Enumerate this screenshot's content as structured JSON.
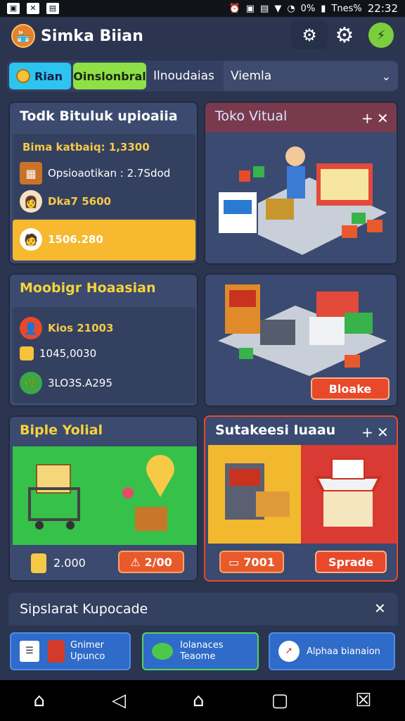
{
  "status_bar": {
    "left_icons": [
      "notification-icon",
      "close-icon",
      "gallery-icon"
    ],
    "battery": "0%",
    "network": "Tnes%",
    "time": "22:32"
  },
  "header": {
    "title": "Simka Biian",
    "icons": [
      "settings-gear-icon",
      "cog-icon",
      "lightning-icon"
    ]
  },
  "filter": {
    "chip_blue": "Rian",
    "chip_green": "Oinslonbral",
    "label": "Ilnoudaias",
    "select_value": "Viemla"
  },
  "card_stock": {
    "title": "Todk Bituluk upioaiia",
    "row1": "Bima katbaiq: 1,3300",
    "row2": "Opsioaotikan : 2.7Sdod",
    "row3": "Dka7 5600",
    "row4": "1506.280"
  },
  "card_toko": {
    "title": "Toko Vitual",
    "plus": "+",
    "close": "✕"
  },
  "card_modal": {
    "title": "Moobigr Hoaasian",
    "row1": "Kios 21003",
    "row2": "1045,0030",
    "row3": "3LO3S.A295"
  },
  "card_warehouse": {
    "button": "Bloake"
  },
  "card_bipie": {
    "title": "Biple Yolial",
    "value": "2.000",
    "button": "2/00"
  },
  "card_sutake": {
    "title": "Sutakeesi Iuaau",
    "plus": "+",
    "close": "✕",
    "button1": "7001",
    "button2": "Sprade"
  },
  "upgrade_bar": {
    "label": "Sipslarat Kupocade",
    "close": "✕"
  },
  "bottom_tabs": [
    {
      "line1": "Gnimer",
      "line2": "Upunco"
    },
    {
      "line1": "Iolanaces",
      "line2": "Teaome"
    },
    {
      "line1": "Alphaa bianaion",
      "line2": ""
    }
  ],
  "colors": {
    "background": "#2b3550",
    "card": "#3b4a6e",
    "accent_yellow": "#f6d33c",
    "accent_red": "#e8492b",
    "green_panel": "#35c14a"
  }
}
